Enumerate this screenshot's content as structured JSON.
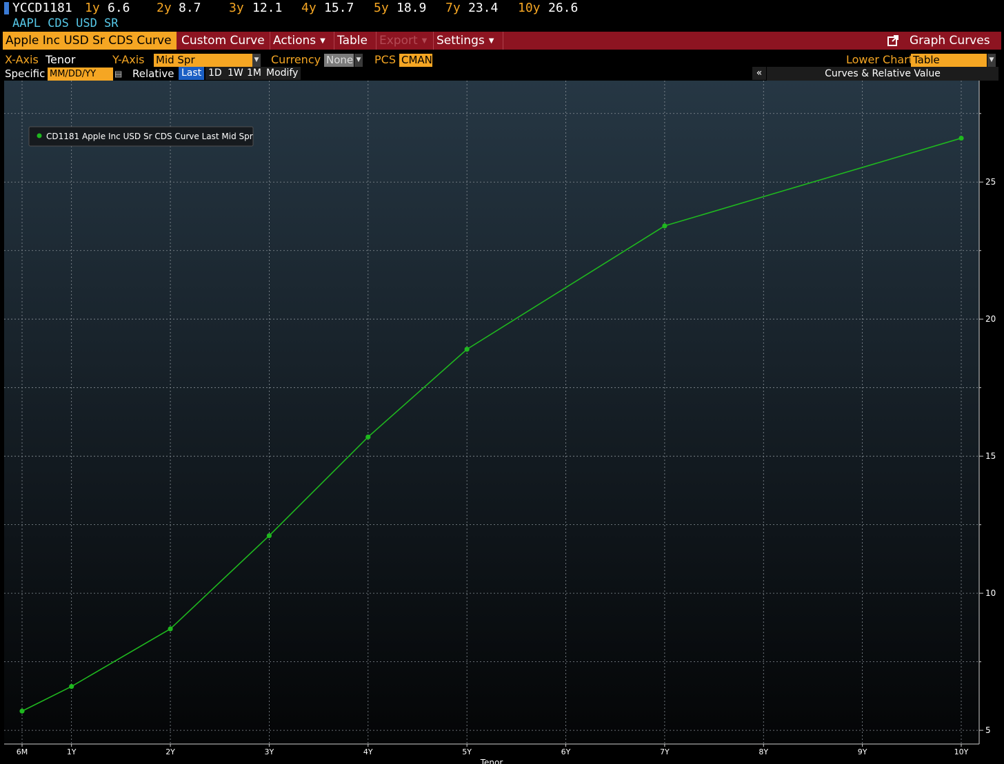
{
  "ticker": {
    "code": "YCCD1181",
    "items": [
      {
        "label": "1y",
        "value": "6.6"
      },
      {
        "label": "2y",
        "value": "8.7"
      },
      {
        "label": "3y",
        "value": "12.1"
      },
      {
        "label": "4y",
        "value": "15.7"
      },
      {
        "label": "5y",
        "value": "18.9"
      },
      {
        "label": "7y",
        "value": "23.4"
      },
      {
        "label": "10y",
        "value": "26.6"
      }
    ],
    "subtitle": "AAPL CDS USD SR"
  },
  "menu": {
    "curve_select": "Apple Inc USD Sr CDS Curve",
    "custom_curve": "Custom Curve",
    "actions": "Actions",
    "table": "Table",
    "export": "Export",
    "settings": "Settings",
    "graph_curves": "Graph Curves"
  },
  "toolbar": {
    "x_axis_label": "X-Axis",
    "x_axis_value": "Tenor",
    "y_axis_label": "Y-Axis",
    "y_axis_value": "Mid Spr",
    "currency_label": "Currency",
    "currency_value": "None",
    "pcs_label": "PCS",
    "pcs_value": "CMAN",
    "lower_chart_label": "Lower Chart",
    "lower_chart_value": "Table",
    "specific_label": "Specific",
    "date_placeholder": "MM/DD/YY",
    "relative_label": "Relative",
    "last": "Last",
    "d1": "1D",
    "w1": "1W",
    "m1": "1M",
    "modify": "Modify",
    "collapse": "«",
    "panel_title": "Curves & Relative Value"
  },
  "colors": {
    "series": "#1fb81f",
    "accent_orange": "#f5a623",
    "menu_red": "#8d1421"
  },
  "chart_data": {
    "type": "line",
    "x": [
      "6M",
      "1Y",
      "2Y",
      "3Y",
      "4Y",
      "5Y",
      "6Y",
      "7Y",
      "8Y",
      "9Y",
      "10Y"
    ],
    "x_positions_years": [
      0.5,
      1,
      2,
      3,
      4,
      5,
      6,
      7,
      8,
      9,
      10
    ],
    "series": [
      {
        "name": "CD1181 Apple Inc USD Sr CDS Curve Last Mid Spr",
        "points": [
          {
            "x": "6M",
            "y": 5.7
          },
          {
            "x": "1Y",
            "y": 6.6
          },
          {
            "x": "2Y",
            "y": 8.7
          },
          {
            "x": "3Y",
            "y": 12.1
          },
          {
            "x": "4Y",
            "y": 15.7
          },
          {
            "x": "5Y",
            "y": 18.9
          },
          {
            "x": "7Y",
            "y": 23.4
          },
          {
            "x": "10Y",
            "y": 26.6
          }
        ]
      }
    ],
    "yticks": [
      5,
      10,
      15,
      20,
      25
    ],
    "ylim": [
      4.5,
      28.7
    ],
    "xlabel": "Tenor",
    "grid": true,
    "legend": "top-left"
  }
}
